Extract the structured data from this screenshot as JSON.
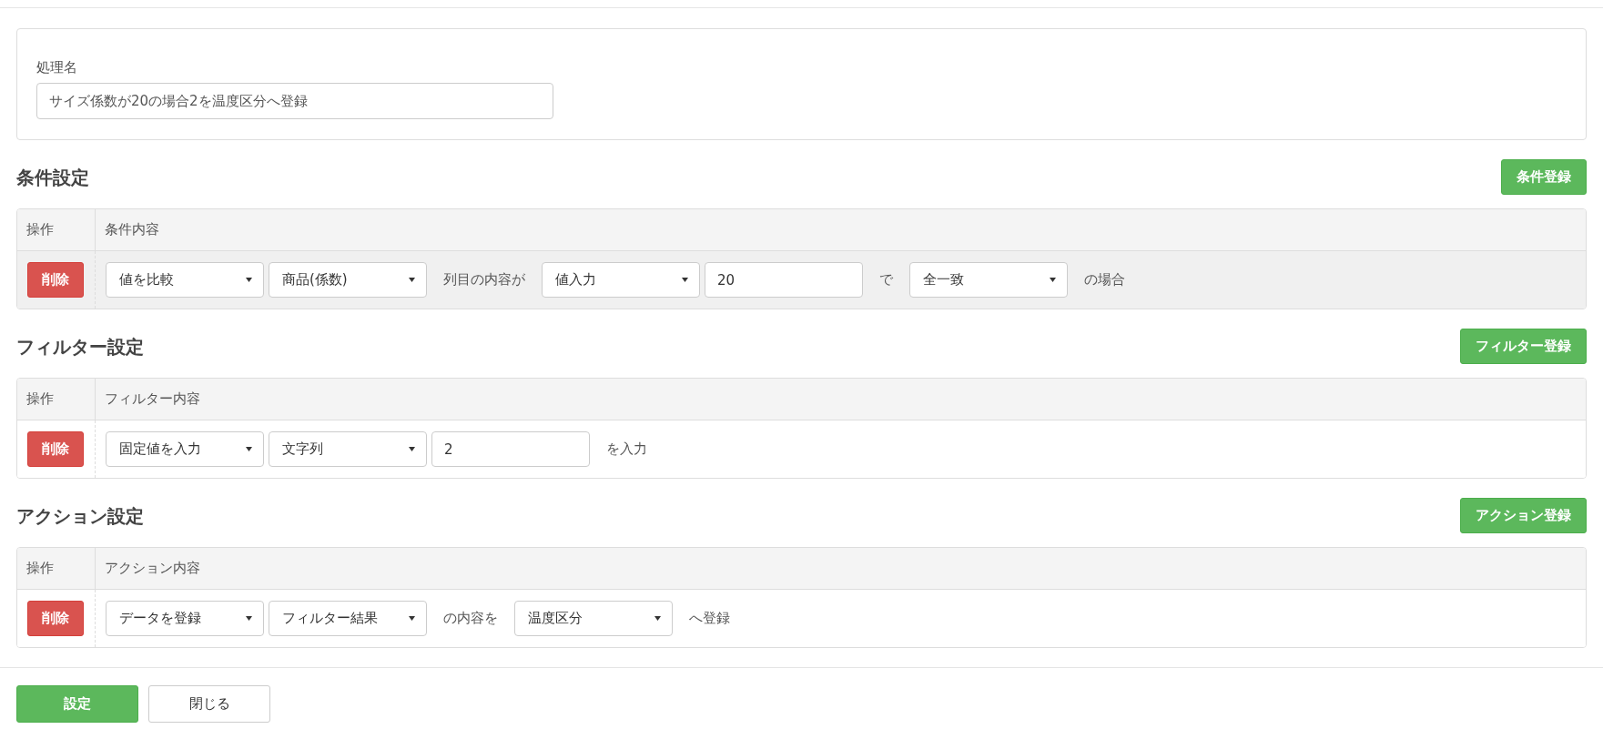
{
  "process_name": {
    "label": "処理名",
    "value": "サイズ係数が20の場合2を温度区分へ登録"
  },
  "sections": [
    {
      "title": "条件設定",
      "register_button": "条件登録",
      "columns": [
        "操作",
        "条件内容"
      ],
      "rows": [
        {
          "highlighted": true,
          "delete_button": "削除",
          "parts": [
            {
              "kind": "select",
              "value": "値を比較"
            },
            {
              "kind": "select",
              "value": "商品(係数)"
            },
            {
              "kind": "text",
              "text": "列目の内容が"
            },
            {
              "kind": "select",
              "value": "値入力"
            },
            {
              "kind": "input",
              "value": "20"
            },
            {
              "kind": "text",
              "text": "で"
            },
            {
              "kind": "select",
              "value": "全一致"
            },
            {
              "kind": "text",
              "text": "の場合"
            }
          ]
        }
      ]
    },
    {
      "title": "フィルター設定",
      "register_button": "フィルター登録",
      "columns": [
        "操作",
        "フィルター内容"
      ],
      "rows": [
        {
          "highlighted": false,
          "delete_button": "削除",
          "parts": [
            {
              "kind": "select",
              "value": "固定値を入力"
            },
            {
              "kind": "select",
              "value": "文字列"
            },
            {
              "kind": "input",
              "value": "2"
            },
            {
              "kind": "text",
              "text": "を入力"
            }
          ]
        }
      ]
    },
    {
      "title": "アクション設定",
      "register_button": "アクション登録",
      "columns": [
        "操作",
        "アクション内容"
      ],
      "rows": [
        {
          "highlighted": false,
          "delete_button": "削除",
          "parts": [
            {
              "kind": "select",
              "value": "データを登録"
            },
            {
              "kind": "select",
              "value": "フィルター結果"
            },
            {
              "kind": "text",
              "text": "の内容を"
            },
            {
              "kind": "select",
              "value": "温度区分"
            },
            {
              "kind": "text",
              "text": "へ登録"
            }
          ]
        }
      ]
    }
  ],
  "footer_buttons": [
    {
      "kind": "primary",
      "label": "設定"
    },
    {
      "kind": "default",
      "label": "閉じる"
    }
  ]
}
